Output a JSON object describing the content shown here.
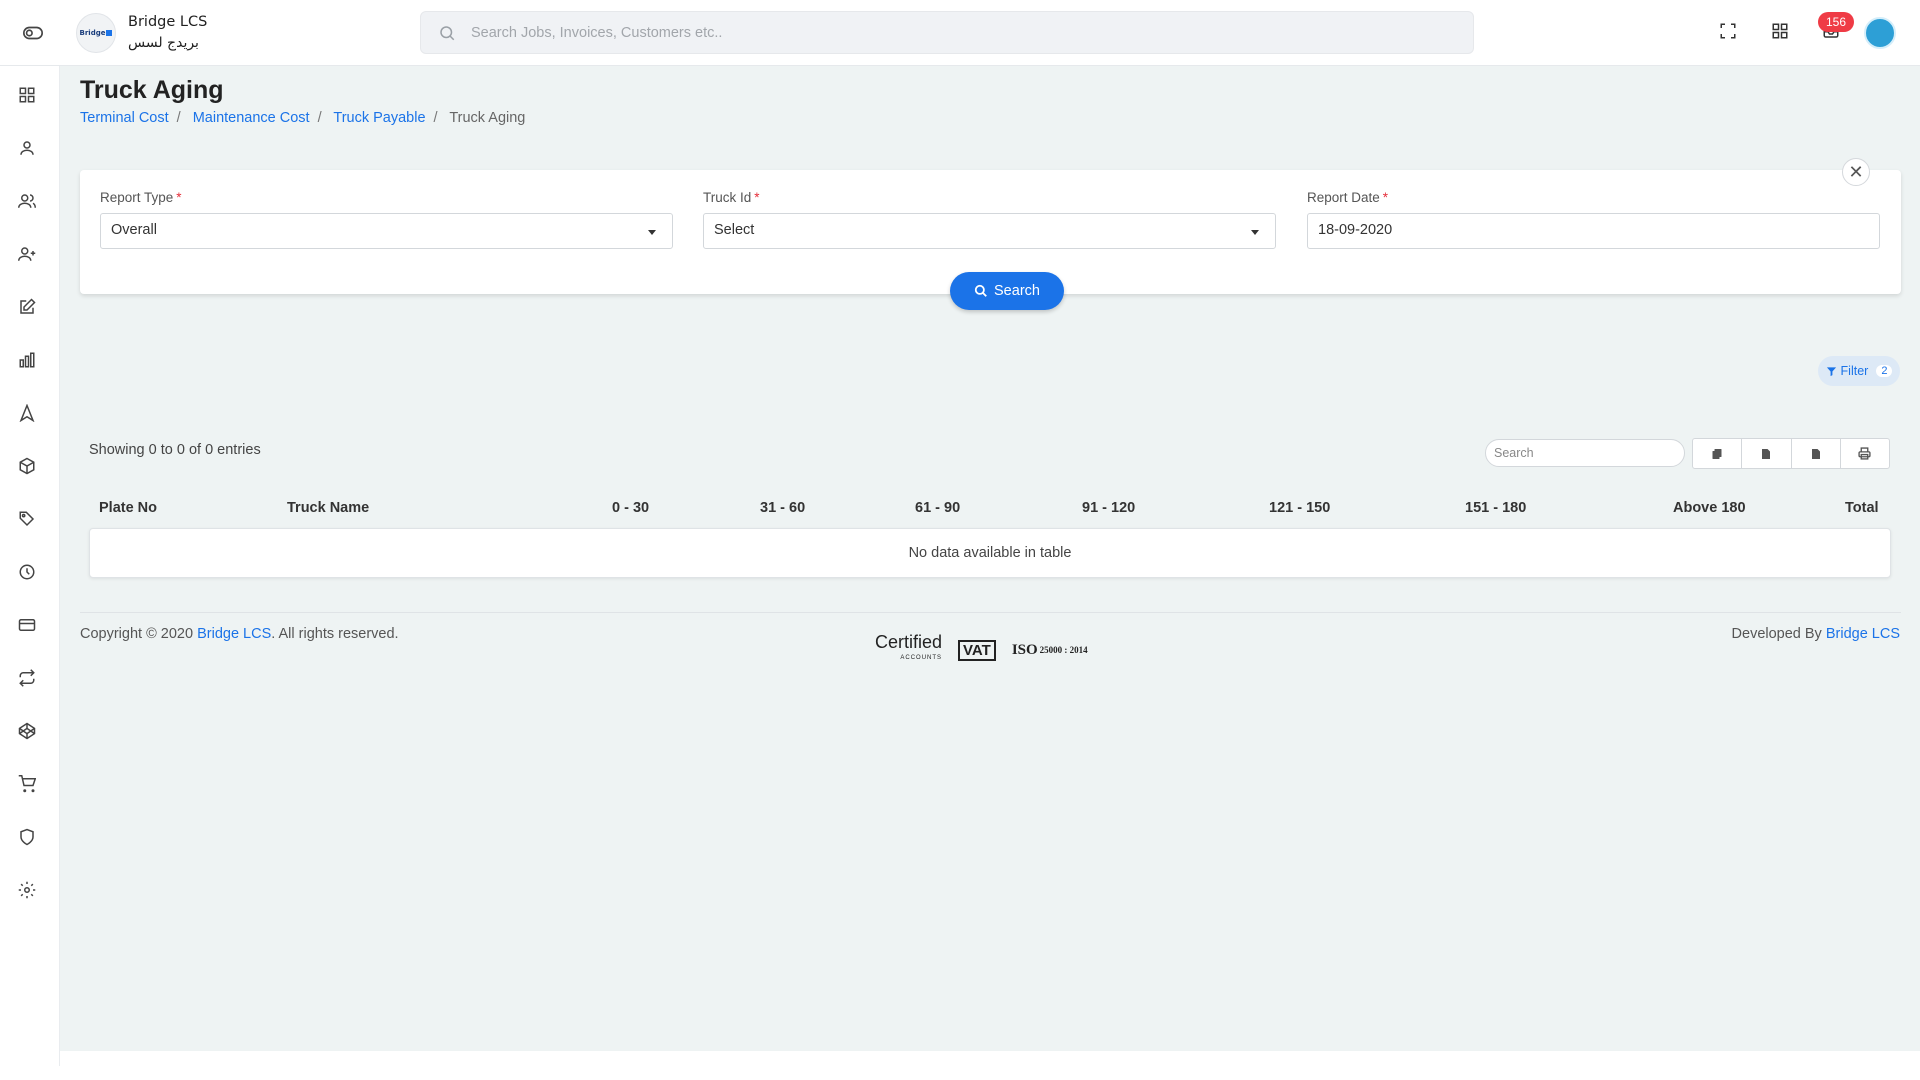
{
  "brand": {
    "name": "Bridge LCS",
    "arabic": "بريدج لسس",
    "logo_text": "Bridge"
  },
  "global_search": {
    "placeholder": "Search Jobs, Invoices, Customers etc.."
  },
  "notifications": {
    "count": "156"
  },
  "page": {
    "title": "Truck Aging",
    "breadcrumb": [
      "Terminal Cost",
      "Maintenance Cost",
      "Truck Payable",
      "Truck Aging"
    ]
  },
  "form": {
    "report_type": {
      "label": "Report Type",
      "value": "Overall"
    },
    "truck_id": {
      "label": "Truck Id",
      "value": "Select"
    },
    "report_date": {
      "label": "Report Date",
      "value": "18-09-2020"
    },
    "required_mark": "*",
    "search_label": "Search"
  },
  "filter": {
    "label": "Filter",
    "count": "2"
  },
  "table": {
    "info": "Showing 0 to 0 of 0 entries",
    "search_placeholder": "Search",
    "columns": [
      "Plate No",
      "Truck Name",
      "0 - 30",
      "31 - 60",
      "61 - 90",
      "91 - 120",
      "121 - 150",
      "151 - 180",
      "Above 180",
      "Total"
    ],
    "empty": "No data available in table"
  },
  "footer": {
    "copyright_prefix": "Copyright © 2020 ",
    "copyright_link": "Bridge LCS",
    "copyright_suffix": ". All rights reserved.",
    "developed_prefix": "Developed By ",
    "developed_link": "Bridge LCS",
    "cert_certified": "Certified",
    "cert_accounts": "ACCOUNTS",
    "cert_vat": "VAT",
    "cert_iso": "ISO",
    "cert_iso_num": "25000 : 2014"
  },
  "colors": {
    "accent": "#1b73e8",
    "badge": "#ef3b45",
    "background": "#eef3f3"
  },
  "sidebar_icons": [
    "dashboard-icon",
    "user-icon",
    "users-icon",
    "user-plus-icon",
    "edit-icon",
    "bar-chart-icon",
    "navigation-icon",
    "box-icon",
    "tag-icon",
    "clock-icon",
    "credit-card-icon",
    "repeat-icon",
    "codepen-icon",
    "cart-icon",
    "shield-icon",
    "settings-icon"
  ]
}
